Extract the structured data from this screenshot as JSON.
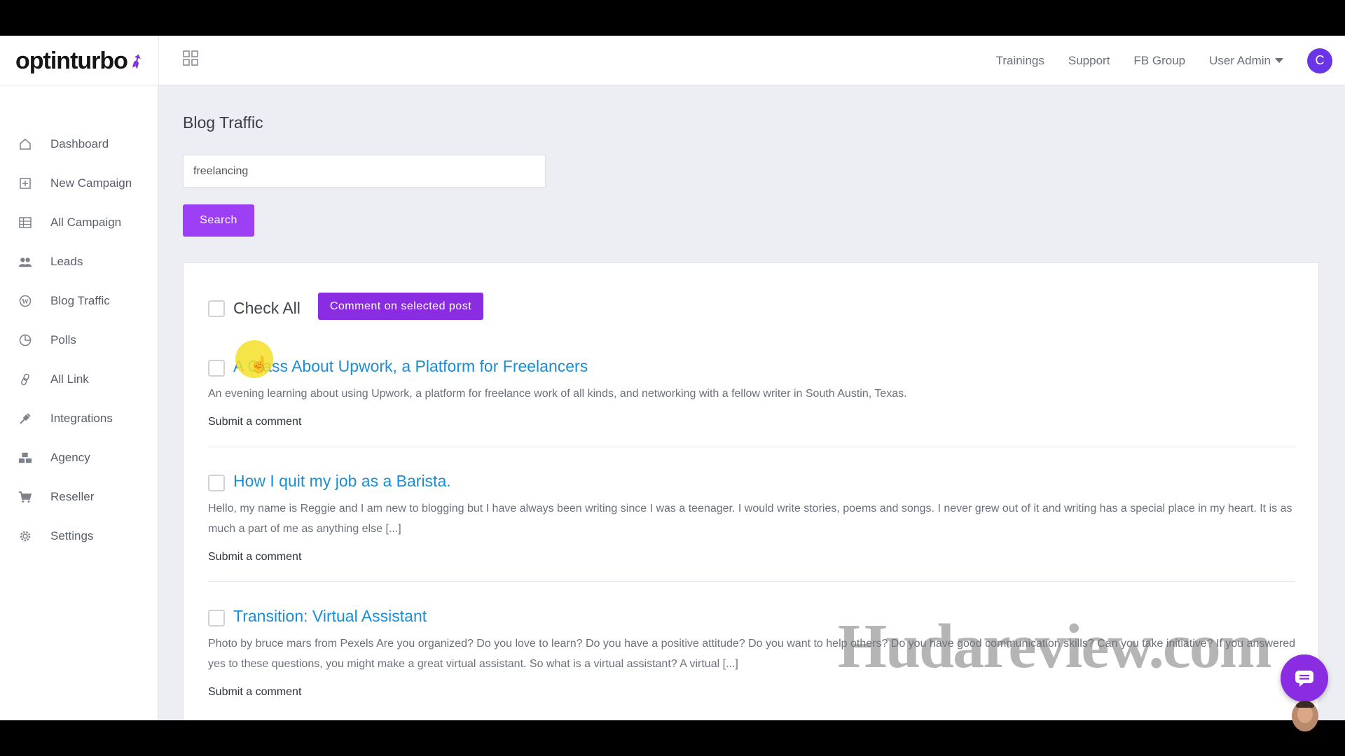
{
  "brand": {
    "logo_text": "optinturbo"
  },
  "topnav": {
    "items": [
      {
        "label": "Trainings"
      },
      {
        "label": "Support"
      },
      {
        "label": "FB Group"
      }
    ],
    "user_menu_label": "User Admin",
    "avatar_letter": "C"
  },
  "sidebar": {
    "items": [
      {
        "label": "Dashboard",
        "icon": "home-icon"
      },
      {
        "label": "New Campaign",
        "icon": "plus-square-icon"
      },
      {
        "label": "All Campaign",
        "icon": "table-icon"
      },
      {
        "label": "Leads",
        "icon": "users-icon"
      },
      {
        "label": "Blog Traffic",
        "icon": "wordpress-icon"
      },
      {
        "label": "Polls",
        "icon": "pie-chart-icon"
      },
      {
        "label": "All Link",
        "icon": "link-icon"
      },
      {
        "label": "Integrations",
        "icon": "plug-icon"
      },
      {
        "label": "Agency",
        "icon": "cubes-icon"
      },
      {
        "label": "Reseller",
        "icon": "cart-icon"
      },
      {
        "label": "Settings",
        "icon": "gear-icon"
      }
    ]
  },
  "main": {
    "title": "Blog Traffic",
    "search_value": "freelancing",
    "search_button": "Search",
    "check_all_label": "Check All",
    "comment_selected_button": "Comment on selected post",
    "posts": [
      {
        "title": "A Class About Upwork, a Platform for Freelancers",
        "excerpt": "An evening learning about using Upwork, a platform for freelance work of all kinds, and networking with a fellow writer in South Austin, Texas.",
        "action": "Submit a comment"
      },
      {
        "title": "How I quit my job as a Barista.",
        "excerpt": "Hello, my name is Reggie and I am new to blogging but I have always been writing since I was a teenager. I would write stories, poems and songs. I never grew out of it and writing has a special place in my heart. It is as much a part of me as anything else [...]",
        "action": "Submit a comment"
      },
      {
        "title": "Transition: Virtual Assistant",
        "excerpt": "Photo by bruce mars from Pexels Are you organized? Do you love to learn? Do you have a positive attitude? Do you want to help others? Do you have good communication skills? Can you take initiative? If you answered yes to these questions, you might make a great virtual assistant. So what is a virtual assistant? A virtual [...]",
        "action": "Submit a comment"
      }
    ]
  },
  "overlay": {
    "watermark": "Hudareview.com"
  },
  "colors": {
    "accent": "#9d40f5",
    "accent_dark": "#8a2ce2",
    "link": "#1b8ed3"
  }
}
